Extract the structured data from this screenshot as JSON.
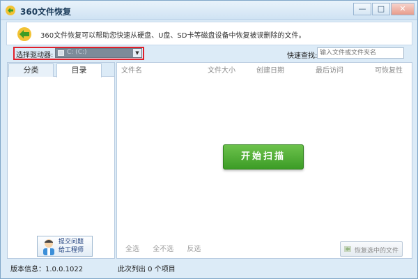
{
  "window": {
    "title": "360文件恢复",
    "minimize_label": "—",
    "maximize_label": "□",
    "close_label": "✕"
  },
  "info": {
    "text": "360文件恢复可以帮助您快速从硬盘、U盘、SD卡等磁盘设备中恢复被误删除的文件。"
  },
  "drive": {
    "label": "选择驱动器:",
    "selected": "C: (C:)",
    "arrow": "▼"
  },
  "search": {
    "label": "快速查找:",
    "placeholder": "输入文件或文件夹名"
  },
  "tabs": [
    {
      "label": "分类"
    },
    {
      "label": "目录"
    }
  ],
  "help": {
    "line1": "提交问题",
    "line2": "给工程师"
  },
  "columns": [
    "文件名",
    "文件大小",
    "创建日期",
    "最后访问",
    "可恢复性"
  ],
  "scan_button": "开始扫描",
  "selection": {
    "select_all": "全选",
    "select_none": "全不选",
    "invert": "反选"
  },
  "recover_button": "恢复选中的文件",
  "status": {
    "version": "版本信息：1.0.0.1022",
    "count": "此次列出 0 个项目"
  },
  "colors": {
    "accent_green": "#3c9c26",
    "highlight_red": "#e0202a",
    "window_bg": "#dcebf7"
  }
}
